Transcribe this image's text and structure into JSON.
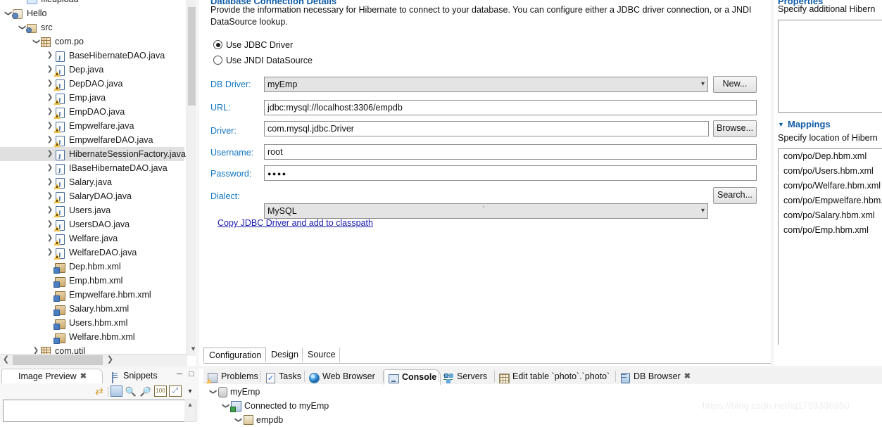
{
  "explorer": {
    "name": "project-explorer",
    "items": [
      {
        "label": "fileupload",
        "indent": 1,
        "twist": "",
        "icon": "folder-icon",
        "partial": true,
        "selected": false
      },
      {
        "label": "Hello",
        "indent": 0,
        "twist": "v",
        "icon": "project-icon",
        "partial": false,
        "selected": false
      },
      {
        "label": "src",
        "indent": 1,
        "twist": "v",
        "icon": "src-folder-icon",
        "partial": false,
        "selected": false
      },
      {
        "label": "com.po",
        "indent": 2,
        "twist": "v",
        "icon": "package-icon",
        "partial": false,
        "selected": false
      },
      {
        "label": "BaseHibernateDAO.java",
        "indent": 3,
        "twist": ">",
        "icon": "java-file-icon",
        "partial": false,
        "selected": false
      },
      {
        "label": "Dep.java",
        "indent": 3,
        "twist": ">",
        "icon": "java-file-warning-icon",
        "partial": false,
        "selected": false
      },
      {
        "label": "DepDAO.java",
        "indent": 3,
        "twist": ">",
        "icon": "java-file-warning-icon",
        "partial": false,
        "selected": false
      },
      {
        "label": "Emp.java",
        "indent": 3,
        "twist": ">",
        "icon": "java-file-warning-icon",
        "partial": false,
        "selected": false
      },
      {
        "label": "EmpDAO.java",
        "indent": 3,
        "twist": ">",
        "icon": "java-file-warning-icon",
        "partial": false,
        "selected": false
      },
      {
        "label": "Empwelfare.java",
        "indent": 3,
        "twist": ">",
        "icon": "java-file-warning-icon",
        "partial": false,
        "selected": false
      },
      {
        "label": "EmpwelfareDAO.java",
        "indent": 3,
        "twist": ">",
        "icon": "java-file-warning-icon",
        "partial": false,
        "selected": false
      },
      {
        "label": "HibernateSessionFactory.java",
        "indent": 3,
        "twist": ">",
        "icon": "java-file-icon",
        "partial": false,
        "selected": true
      },
      {
        "label": "IBaseHibernateDAO.java",
        "indent": 3,
        "twist": ">",
        "icon": "java-file-icon",
        "partial": false,
        "selected": false
      },
      {
        "label": "Salary.java",
        "indent": 3,
        "twist": ">",
        "icon": "java-file-warning-icon",
        "partial": false,
        "selected": false
      },
      {
        "label": "SalaryDAO.java",
        "indent": 3,
        "twist": ">",
        "icon": "java-file-warning-icon",
        "partial": false,
        "selected": false
      },
      {
        "label": "Users.java",
        "indent": 3,
        "twist": ">",
        "icon": "java-file-warning-icon",
        "partial": false,
        "selected": false
      },
      {
        "label": "UsersDAO.java",
        "indent": 3,
        "twist": ">",
        "icon": "java-file-warning-icon",
        "partial": false,
        "selected": false
      },
      {
        "label": "Welfare.java",
        "indent": 3,
        "twist": ">",
        "icon": "java-file-warning-icon",
        "partial": false,
        "selected": false
      },
      {
        "label": "WelfareDAO.java",
        "indent": 3,
        "twist": ">",
        "icon": "java-file-warning-icon",
        "partial": false,
        "selected": false
      },
      {
        "label": "Dep.hbm.xml",
        "indent": 3,
        "twist": "",
        "icon": "hbm-xml-icon",
        "partial": false,
        "selected": false
      },
      {
        "label": "Emp.hbm.xml",
        "indent": 3,
        "twist": "",
        "icon": "hbm-xml-icon",
        "partial": false,
        "selected": false
      },
      {
        "label": "Empwelfare.hbm.xml",
        "indent": 3,
        "twist": "",
        "icon": "hbm-xml-icon",
        "partial": false,
        "selected": false
      },
      {
        "label": "Salary.hbm.xml",
        "indent": 3,
        "twist": "",
        "icon": "hbm-xml-icon",
        "partial": false,
        "selected": false
      },
      {
        "label": "Users.hbm.xml",
        "indent": 3,
        "twist": "",
        "icon": "hbm-xml-icon",
        "partial": false,
        "selected": false
      },
      {
        "label": "Welfare.hbm.xml",
        "indent": 3,
        "twist": "",
        "icon": "hbm-xml-icon",
        "partial": false,
        "selected": false
      },
      {
        "label": "com.util",
        "indent": 2,
        "twist": ">",
        "icon": "package-icon",
        "partial": true,
        "selected": false
      }
    ]
  },
  "editor": {
    "section_title": "Database Connection Details",
    "description": "Provide the information necessary for Hibernate to connect to your database.  You can configure either a JDBC driver connection, or a JNDI DataSource lookup.",
    "radios": [
      {
        "label": "Use JDBC Driver",
        "selected": true
      },
      {
        "label": "Use JNDI DataSource",
        "selected": false
      }
    ],
    "fields": [
      {
        "label": "DB Driver:",
        "value": "myEmp",
        "type": "combo",
        "button": "New..."
      },
      {
        "label": "URL:",
        "value": "jdbc:mysql://localhost:3306/empdb",
        "type": "text",
        "button": ""
      },
      {
        "label": "Driver:",
        "value": "com.mysql.jdbc.Driver",
        "type": "text",
        "button": "Browse..."
      },
      {
        "label": "Username:",
        "value": "root",
        "type": "text",
        "button": ""
      },
      {
        "label": "Password:",
        "value": "●●●●",
        "type": "text",
        "button": ""
      },
      {
        "label": "Dialect:",
        "value": "MySQL",
        "type": "combo",
        "button": "Search..."
      }
    ],
    "link": "Copy JDBC Driver and add to classpath",
    "tabs": [
      {
        "label": "Configuration",
        "active": true
      },
      {
        "label": "Design",
        "active": false
      },
      {
        "label": "Source",
        "active": false
      }
    ]
  },
  "right_panel": {
    "properties": {
      "title": "Properties",
      "description": "Specify additional Hibern"
    },
    "mappings": {
      "title": "Mappings",
      "description": "Specify location of Hibern",
      "items": [
        "com/po/Dep.hbm.xml",
        "com/po/Users.hbm.xml",
        "com/po/Welfare.hbm.xml",
        "com/po/Empwelfare.hbm.xml",
        "com/po/Salary.hbm.xml",
        "com/po/Emp.hbm.xml"
      ]
    }
  },
  "bottom_left": {
    "tabs": [
      {
        "label": "Image Preview",
        "icon": "eye-icon",
        "active": true,
        "closable": true
      },
      {
        "label": "Snippets",
        "icon": "snippets-icon",
        "active": false,
        "closable": false
      }
    ],
    "toolbar_icons": [
      "sync-arrows-icon",
      "fit-image-icon",
      "zoom-out-icon",
      "zoom-in-icon",
      "zoom-100-icon",
      "zoom-fit-icon",
      "view-menu-icon"
    ],
    "window_buttons": [
      "minimize-icon",
      "maximize-icon"
    ]
  },
  "bottom_right": {
    "tabs": [
      {
        "label": "Problems",
        "icon": "problems-icon",
        "active": false,
        "closable": false
      },
      {
        "label": "Tasks",
        "icon": "tasks-icon",
        "active": false,
        "closable": false
      },
      {
        "label": "Web Browser",
        "icon": "globe-icon",
        "active": false,
        "closable": false
      },
      {
        "label": "Console",
        "icon": "console-icon",
        "active": true,
        "closable": false
      },
      {
        "label": "Servers",
        "icon": "servers-icon",
        "active": false,
        "closable": false
      },
      {
        "label": "Edit table `photo`.`photo`",
        "icon": "edit-table-icon",
        "active": false,
        "closable": false
      },
      {
        "label": "DB Browser",
        "icon": "db-browser-icon",
        "active": false,
        "closable": true
      }
    ],
    "tree": [
      {
        "label": "myEmp",
        "indent": 0,
        "twist": "v",
        "icon": "database-icon"
      },
      {
        "label": "Connected to myEmp",
        "indent": 1,
        "twist": "v",
        "icon": "connection-icon"
      },
      {
        "label": "empdb",
        "indent": 2,
        "twist": "v",
        "icon": "schema-icon"
      }
    ]
  },
  "watermark": "https://blog.csdn.net/lq1759336950",
  "colors": {
    "section_title": "#0f5ca8",
    "field_label": "#1177c4",
    "link": "#1a1ab0",
    "selection": "#e0e0e0"
  }
}
